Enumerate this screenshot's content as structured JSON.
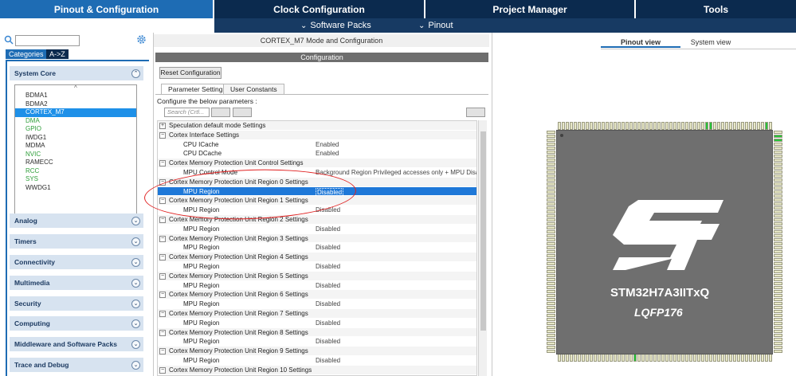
{
  "top_tabs": [
    {
      "label": "Pinout & Configuration",
      "active": true
    },
    {
      "label": "Clock Configuration",
      "active": false
    },
    {
      "label": "Project Manager",
      "active": false
    },
    {
      "label": "Tools",
      "active": false
    }
  ],
  "sub_bar": {
    "software_packs": "Software Packs",
    "pinout": "Pinout"
  },
  "left_panel": {
    "category_tabs": [
      "Categories",
      "A->Z"
    ],
    "sections": [
      {
        "label": "System Core",
        "expanded": true
      },
      {
        "label": "Analog"
      },
      {
        "label": "Timers"
      },
      {
        "label": "Connectivity"
      },
      {
        "label": "Multimedia"
      },
      {
        "label": "Security"
      },
      {
        "label": "Computing"
      },
      {
        "label": "Middleware and Software Packs"
      },
      {
        "label": "Trace and Debug"
      }
    ],
    "system_core_items": [
      {
        "label": "BDMA1",
        "style": "normal"
      },
      {
        "label": "BDMA2",
        "style": "normal"
      },
      {
        "label": "CORTEX_M7",
        "style": "selected"
      },
      {
        "label": "DMA",
        "style": "green"
      },
      {
        "label": "GPIO",
        "style": "green"
      },
      {
        "label": "IWDG1",
        "style": "normal"
      },
      {
        "label": "MDMA",
        "style": "normal"
      },
      {
        "label": "NVIC",
        "style": "green"
      },
      {
        "label": "RAMECC",
        "style": "normal"
      },
      {
        "label": "RCC",
        "style": "green"
      },
      {
        "label": "SYS",
        "style": "green"
      },
      {
        "label": "WWDG1",
        "style": "normal"
      }
    ]
  },
  "middle_panel": {
    "title": "CORTEX_M7 Mode and Configuration",
    "config_header": "Configuration",
    "reset_button": "Reset Configuration",
    "param_tabs": [
      "Parameter Settings",
      "User Constants"
    ],
    "configure_label": "Configure the below parameters :",
    "search_placeholder": "Search (Crtl...",
    "rows": [
      {
        "type": "group",
        "expander": "+",
        "name": "Speculation default mode Settings"
      },
      {
        "type": "group",
        "expander": "−",
        "name": "Cortex Interface Settings"
      },
      {
        "type": "param",
        "name": "CPU ICache",
        "value": "Enabled"
      },
      {
        "type": "param",
        "name": "CPU DCache",
        "value": "Enabled"
      },
      {
        "type": "group",
        "expander": "−",
        "name": "Cortex Memory Protection Unit Control Settings"
      },
      {
        "type": "param",
        "name": "MPU Control Mode",
        "value": "Background Region Privileged accesses only + MPU Disabled..."
      },
      {
        "type": "group",
        "expander": "−",
        "name": "Cortex Memory Protection Unit Region 0 Settings"
      },
      {
        "type": "param",
        "name": "MPU Region",
        "value": "Disabled",
        "selected": true
      },
      {
        "type": "group",
        "expander": "−",
        "name": "Cortex Memory Protection Unit Region 1 Settings"
      },
      {
        "type": "param",
        "name": "MPU Region",
        "value": "Disabled"
      },
      {
        "type": "group",
        "expander": "−",
        "name": "Cortex Memory Protection Unit Region 2 Settings"
      },
      {
        "type": "param",
        "name": "MPU Region",
        "value": "Disabled"
      },
      {
        "type": "group",
        "expander": "−",
        "name": "Cortex Memory Protection Unit Region 3 Settings"
      },
      {
        "type": "param",
        "name": "MPU Region",
        "value": "Disabled"
      },
      {
        "type": "group",
        "expander": "−",
        "name": "Cortex Memory Protection Unit Region 4 Settings"
      },
      {
        "type": "param",
        "name": "MPU Region",
        "value": "Disabled"
      },
      {
        "type": "group",
        "expander": "−",
        "name": "Cortex Memory Protection Unit Region 5 Settings"
      },
      {
        "type": "param",
        "name": "MPU Region",
        "value": "Disabled"
      },
      {
        "type": "group",
        "expander": "−",
        "name": "Cortex Memory Protection Unit Region 6 Settings"
      },
      {
        "type": "param",
        "name": "MPU Region",
        "value": "Disabled"
      },
      {
        "type": "group",
        "expander": "−",
        "name": "Cortex Memory Protection Unit Region 7 Settings"
      },
      {
        "type": "param",
        "name": "MPU Region",
        "value": "Disabled"
      },
      {
        "type": "group",
        "expander": "−",
        "name": "Cortex Memory Protection Unit Region 8 Settings"
      },
      {
        "type": "param",
        "name": "MPU Region",
        "value": "Disabled"
      },
      {
        "type": "group",
        "expander": "−",
        "name": "Cortex Memory Protection Unit Region 9 Settings"
      },
      {
        "type": "param",
        "name": "MPU Region",
        "value": "Disabled"
      },
      {
        "type": "group",
        "expander": "−",
        "name": "Cortex Memory Protection Unit Region 10 Settings"
      }
    ]
  },
  "right_panel": {
    "view_tabs": [
      "Pinout view",
      "System view"
    ],
    "chip_name": "STM32H7A3IITxQ",
    "package": "LQFP176"
  },
  "colors": {
    "top_bar": "#0b2a4e",
    "active_tab": "#1e6cb4",
    "selected_row": "#1e78d8",
    "pin_green": "#27c43a",
    "chip_body": "#6f6f6f",
    "annotation_red": "#e02020"
  }
}
